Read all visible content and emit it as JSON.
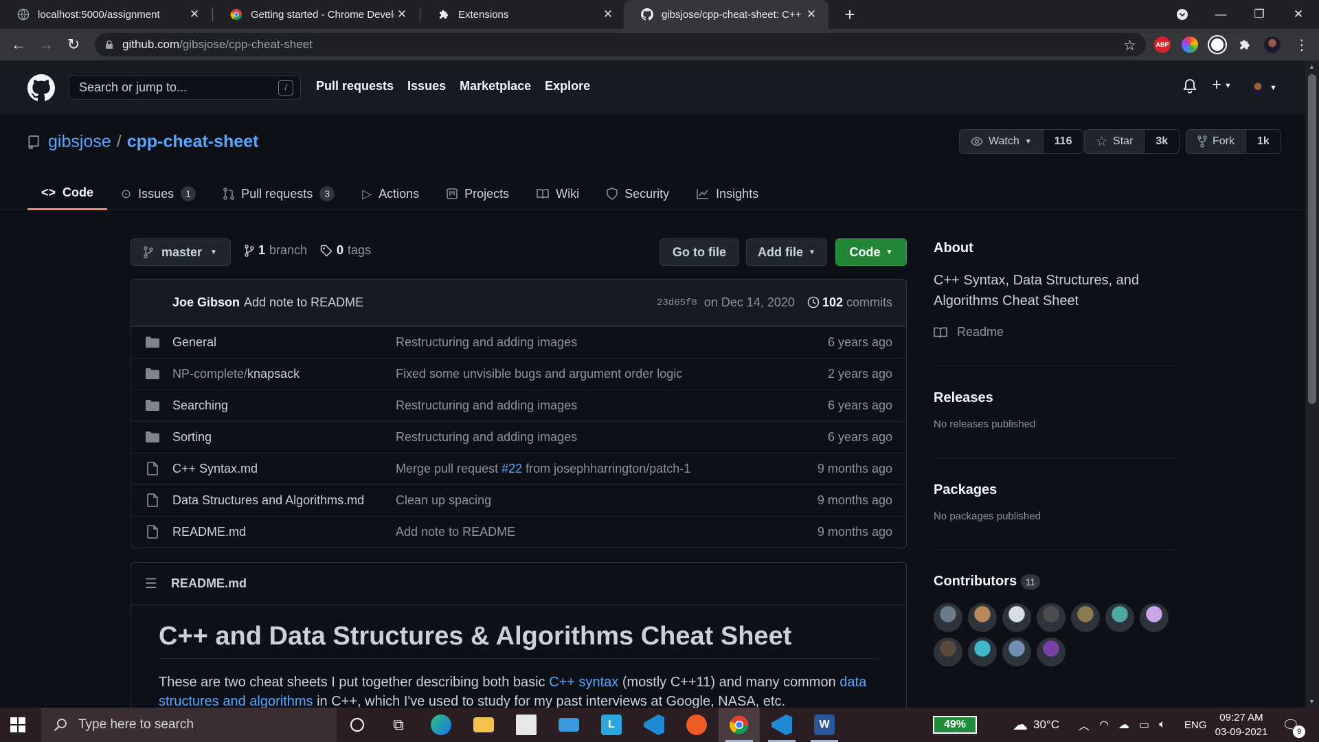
{
  "browser": {
    "tabs": [
      {
        "title": "localhost:5000/assignment",
        "active": false
      },
      {
        "title": "Getting started - Chrome Developers",
        "active": false
      },
      {
        "title": "Extensions",
        "active": false
      },
      {
        "title": "gibsjose/cpp-cheat-sheet: C++ Syntax",
        "active": true
      }
    ],
    "new_tab": "+",
    "url_host": "github.com",
    "url_path": "/gibsjose/cpp-cheat-sheet",
    "extensions": [
      "ABP"
    ]
  },
  "github": {
    "search_placeholder": "Search or jump to...",
    "search_shortcut": "/",
    "nav": [
      "Pull requests",
      "Issues",
      "Marketplace",
      "Explore"
    ],
    "plus": "+"
  },
  "repo": {
    "owner": "gibsjose",
    "separator": "/",
    "name": "cpp-cheat-sheet",
    "watch_label": "Watch",
    "watch_count": "116",
    "star_label": "Star",
    "star_count": "3k",
    "fork_label": "Fork",
    "fork_count": "1k",
    "tabs": [
      {
        "label": "Code",
        "counter": ""
      },
      {
        "label": "Issues",
        "counter": "1"
      },
      {
        "label": "Pull requests",
        "counter": "3"
      },
      {
        "label": "Actions",
        "counter": ""
      },
      {
        "label": "Projects",
        "counter": ""
      },
      {
        "label": "Wiki",
        "counter": ""
      },
      {
        "label": "Security",
        "counter": ""
      },
      {
        "label": "Insights",
        "counter": ""
      }
    ]
  },
  "code": {
    "branch": "master",
    "branch_count": "1",
    "branch_label": "branch",
    "tag_count": "0",
    "tag_label": "tags",
    "go_to_file": "Go to file",
    "add_file": "Add file",
    "code_button": "Code",
    "commit": {
      "author": "Joe Gibson",
      "message": "Add note to README",
      "sha": "23d65f8",
      "date": "on Dec 14, 2020",
      "count": "102",
      "count_label": "commits"
    },
    "files": [
      {
        "type": "dir",
        "name": "General",
        "name_prefix": "",
        "message": "Restructuring and adding images",
        "message_link": "",
        "message_suffix": "",
        "age": "6 years ago"
      },
      {
        "type": "dir",
        "name": "knapsack",
        "name_prefix": "NP-complete/",
        "message": "Fixed some unvisible bugs and argument order logic",
        "message_link": "",
        "message_suffix": "",
        "age": "2 years ago"
      },
      {
        "type": "dir",
        "name": "Searching",
        "name_prefix": "",
        "message": "Restructuring and adding images",
        "message_link": "",
        "message_suffix": "",
        "age": "6 years ago"
      },
      {
        "type": "dir",
        "name": "Sorting",
        "name_prefix": "",
        "message": "Restructuring and adding images",
        "message_link": "",
        "message_suffix": "",
        "age": "6 years ago"
      },
      {
        "type": "file",
        "name": "C++ Syntax.md",
        "name_prefix": "",
        "message": "Merge pull request ",
        "message_link": "#22",
        "message_suffix": " from josephharrington/patch-1",
        "age": "9 months ago"
      },
      {
        "type": "file",
        "name": "Data Structures and Algorithms.md",
        "name_prefix": "",
        "message": "Clean up spacing",
        "message_link": "",
        "message_suffix": "",
        "age": "9 months ago"
      },
      {
        "type": "file",
        "name": "README.md",
        "name_prefix": "",
        "message": "Add note to README",
        "message_link": "",
        "message_suffix": "",
        "age": "9 months ago"
      }
    ]
  },
  "readme": {
    "filename": "README.md",
    "heading": "C++ and Data Structures & Algorithms Cheat Sheet",
    "p_1": "These are two cheat sheets I put together describing both basic ",
    "p_link1": "C++ syntax",
    "p_2": " (mostly C++11) and many common ",
    "p_link2": "data structures and algorithms",
    "p_3": " in C++, which I've used to study for my past interviews at Google, NASA, etc."
  },
  "sidebar": {
    "about_title": "About",
    "about_desc": "C++ Syntax, Data Structures, and Algorithms Cheat Sheet",
    "readme_link": "Readme",
    "releases_title": "Releases",
    "releases_sub": "No releases published",
    "packages_title": "Packages",
    "packages_sub": "No packages published",
    "contributors_title": "Contributors",
    "contributors_count": "11",
    "avatar_colors": [
      "#6b7b8c",
      "#b58a5a",
      "#d7dce6",
      "#4d4d4d",
      "#8c7a52",
      "#4fa8a0",
      "#c9a6e8",
      "#5a4a3e",
      "#3fb6c9",
      "#6f8fb5",
      "#7b3fa8"
    ]
  },
  "taskbar": {
    "search_placeholder": "Type here to search",
    "battery": "49%",
    "temperature": "30°C",
    "language": "ENG",
    "time": "09:27 AM",
    "date": "03-09-2021",
    "notification_count": "9"
  },
  "colors": {
    "link": "#58a6ff",
    "green_button": "#238636",
    "active_tab_underline": "#f78166"
  }
}
